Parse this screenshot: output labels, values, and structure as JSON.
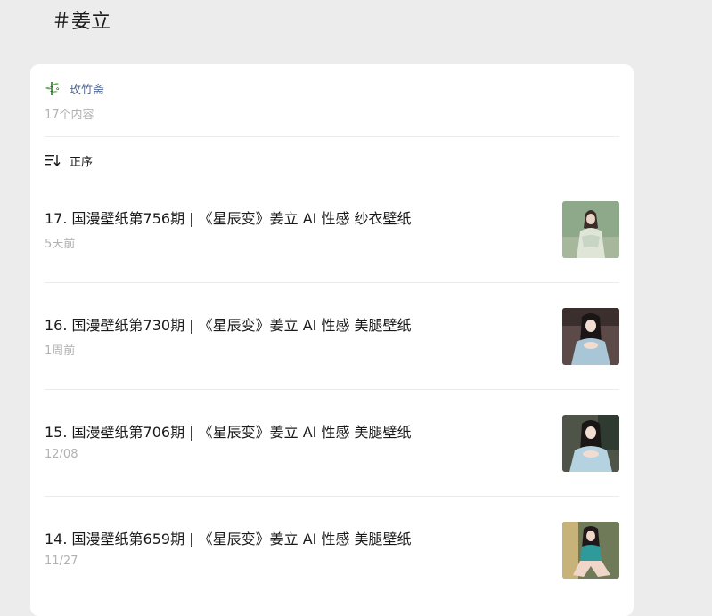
{
  "page": {
    "title": "＃姜立"
  },
  "account": {
    "name": "玫竹斋",
    "avatar_icon": "bamboo-avatar-icon",
    "content_count": "17个内容"
  },
  "sort": {
    "label": "正序",
    "icon": "sort-order-icon"
  },
  "articles": [
    {
      "title": "17. 国漫壁纸第756期 | 《星辰变》姜立 AI 性感 纱衣壁纸",
      "date": "5天前",
      "thumb_bg": "#8da98a",
      "thumb_accent": "#dfe6d8"
    },
    {
      "title": "16. 国漫壁纸第730期 | 《星辰变》姜立 AI 性感 美腿壁纸",
      "date": "1周前",
      "thumb_bg": "#5b4a48",
      "thumb_accent": "#a9c6d6"
    },
    {
      "title": "15. 国漫壁纸第706期 | 《星辰变》姜立 AI 性感 美腿壁纸",
      "date": "12/08",
      "thumb_bg": "#4e5548",
      "thumb_accent": "#b4d2e0"
    },
    {
      "title": "14. 国漫壁纸第659期 | 《星辰变》姜立 AI 性感 美腿壁纸",
      "date": "11/27",
      "thumb_bg": "#6f7a58",
      "thumb_accent": "#2f9a9a"
    }
  ],
  "colors": {
    "background": "#ececec",
    "card": "#ffffff",
    "link": "#576b95",
    "muted": "#b2b2b2"
  }
}
